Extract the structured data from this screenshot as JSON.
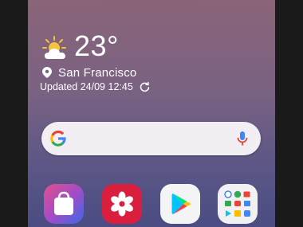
{
  "weather": {
    "icon": "partly-cloudy-icon",
    "temperature": "23°",
    "location": "San Francisco",
    "updated": "Updated 24/09 12:45"
  },
  "search": {
    "logo": "google-g-logo",
    "mic_icon": "microphone-icon"
  },
  "dock": {
    "apps": [
      {
        "icon": "galaxy-store-icon"
      },
      {
        "icon": "gallery-icon"
      },
      {
        "icon": "play-store-icon"
      },
      {
        "icon": "google-folder-icon"
      }
    ]
  },
  "colors": {
    "wallpaper_top": "#8a6478",
    "wallpaper_bottom": "#4a4c82",
    "search_bg": "#f1eff4",
    "mic_blue": "#4285f4",
    "mic_red": "#ea4335"
  }
}
